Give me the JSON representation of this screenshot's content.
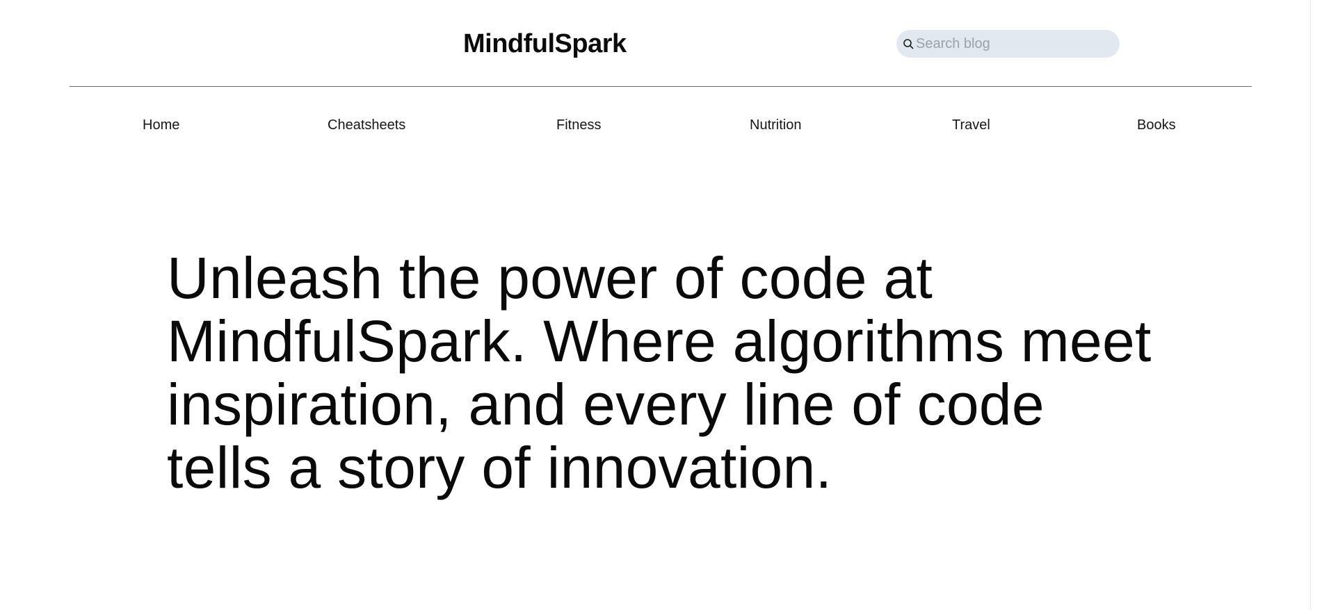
{
  "header": {
    "brand": "MindfulSpark",
    "search": {
      "placeholder": "Search blog",
      "value": "",
      "icon": "search-icon"
    }
  },
  "nav": {
    "items": [
      {
        "label": "Home"
      },
      {
        "label": "Cheatsheets"
      },
      {
        "label": "Fitness"
      },
      {
        "label": "Nutrition"
      },
      {
        "label": "Travel"
      },
      {
        "label": "Books"
      }
    ]
  },
  "hero": {
    "text": "Unleash the power of code at MindfulSpark. Where algorithms meet inspiration, and every line of code tells a story of innovation."
  },
  "colors": {
    "search_bg": "#e2e8f0",
    "text": "#0a0a0a",
    "divider": "#6b6b6b"
  }
}
